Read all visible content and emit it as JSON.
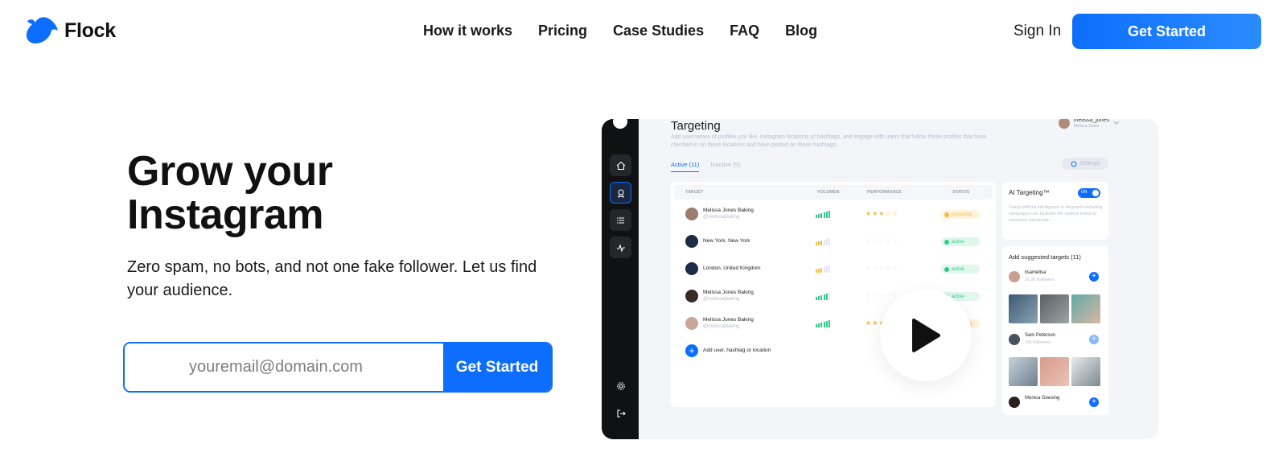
{
  "nav": {
    "logo_text": "Flock",
    "links": [
      "How it works",
      "Pricing",
      "Case Studies",
      "FAQ",
      "Blog"
    ],
    "sign_in": "Sign In",
    "cta": "Get Started"
  },
  "hero": {
    "title_line1": "Grow your",
    "title_line2": "Instagram",
    "subtitle": "Zero spam, no bots, and not one fake follower. Let us find your audience.",
    "email_placeholder": "youremail@domain.com",
    "cta": "Get Started"
  },
  "mockup": {
    "title": "Targeting",
    "description": "Add usernames of profiles you like, Instagram locations or hashtags, and engage with users that follow these profiles that have checked-in on these locations and have posted on these hashtags.",
    "user_name": "melissa_jones",
    "user_sub": "Melissa Jones",
    "tab_active": "Active (11)",
    "tab_inactive": "Inactive (5)",
    "settings": "Settings",
    "columns": {
      "target": "TARGET",
      "volumen": "VOLUMEN",
      "performance": "PERFORMANCE",
      "status": "STATUS"
    },
    "rows": [
      {
        "name": "Melissa Jones Baking",
        "handle": "@melissajbaking",
        "status": "preparing",
        "stars": "★★★☆☆"
      },
      {
        "name": "New York, New York",
        "handle": "",
        "status": "active",
        "stars": "☆☆☆☆☆"
      },
      {
        "name": "London, United Kingdom",
        "handle": "",
        "status": "active",
        "stars": "☆☆☆☆☆"
      },
      {
        "name": "Melissa Jones Baking",
        "handle": "@melissajbaking",
        "status": "active",
        "stars": "☆☆☆☆☆"
      },
      {
        "name": "Melissa Jones Baking",
        "handle": "@melissajbaking",
        "status": "preparing",
        "stars": "★★★☆☆"
      }
    ],
    "add_label": "Add user, hashtag or location",
    "ai_title": "AI Targeting™",
    "ai_toggle": "ON",
    "ai_text": "Using artificial intelligence in targeted marketing campaigns can facilitate the optimal brand to consumer interaction.",
    "suggested_title": "Add suggested targets (11)",
    "suggested": [
      {
        "name": "lisamelisa",
        "sub": "16.2k followers"
      },
      {
        "name": "Sam Peterson",
        "sub": "15k followers"
      },
      {
        "name": "Monica Goesing",
        "sub": ""
      }
    ]
  },
  "colors": {
    "accent": "#0d6efd",
    "active_green": "#2ecc8b",
    "preparing_orange": "#f5b942",
    "sidebar": "#101113"
  }
}
